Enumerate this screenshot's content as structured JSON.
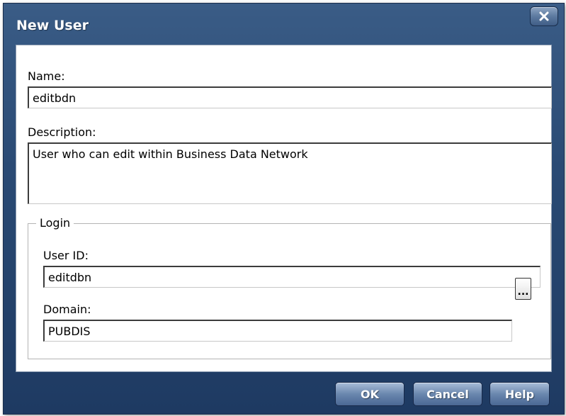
{
  "dialog": {
    "title": "New User",
    "close_icon": "close-icon"
  },
  "form": {
    "name_label": "Name:",
    "name_value": "editbdn",
    "description_label": "Description:",
    "description_value": "User who can edit within Business Data Network"
  },
  "login": {
    "legend": "Login",
    "user_id_label": "User ID:",
    "user_id_value": "editdbn",
    "domain_label": "Domain:",
    "domain_value": "PUBDIS",
    "browse_label": "..."
  },
  "buttons": {
    "ok": "OK",
    "cancel": "Cancel",
    "help": "Help"
  },
  "colors": {
    "frame": "#2a4a74",
    "button": "#6a87ae"
  }
}
